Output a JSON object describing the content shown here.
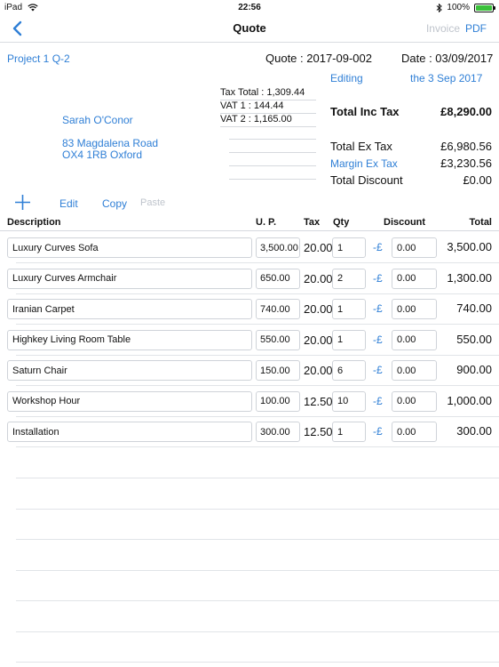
{
  "status_bar": {
    "carrier": "iPad",
    "time": "22:56",
    "battery": "100%"
  },
  "nav": {
    "title": "Quote",
    "invoice_label": "Invoice",
    "pdf_label": "PDF"
  },
  "header": {
    "project": "Project 1 Q-2",
    "quote_no": "Quote : 2017-09-002",
    "date": "Date : 03/09/2017",
    "editing": "Editing",
    "editing_date": "the 3 Sep 2017",
    "tax_total": "Tax Total : 1,309.44",
    "vat1": "VAT 1 :  144.44",
    "vat2": "VAT 2 :  1,165.00",
    "customer_name": "Sarah O'Conor",
    "address_line1": "83 Magdalena Road",
    "address_line2": "OX4 1RB Oxford"
  },
  "totals": {
    "inc_tax_label": "Total Inc Tax",
    "inc_tax_value": "£8,290.00",
    "ex_tax_label": "Total Ex Tax",
    "ex_tax_value": "£6,980.56",
    "margin_label": "Margin Ex Tax",
    "margin_value": "£3,230.56",
    "discount_label": "Total Discount",
    "discount_value": "£0.00"
  },
  "toolbar": {
    "add": "+",
    "edit": "Edit",
    "copy": "Copy",
    "paste": "Paste"
  },
  "columns": {
    "description": "Description",
    "up": "U. P.",
    "tax": "Tax",
    "qty": "Qty",
    "discount": "Discount",
    "total": "Total"
  },
  "rows": [
    {
      "description": "Luxury Curves Sofa",
      "up": "3,500.00",
      "tax": "20.00",
      "qty": "1",
      "disc_type": "-£",
      "discount": "0.00",
      "total": "3,500.00"
    },
    {
      "description": "Luxury Curves Armchair",
      "up": "650.00",
      "tax": "20.00",
      "qty": "2",
      "disc_type": "-£",
      "discount": "0.00",
      "total": "1,300.00"
    },
    {
      "description": "Iranian Carpet",
      "up": "740.00",
      "tax": "20.00",
      "qty": "1",
      "disc_type": "-£",
      "discount": "0.00",
      "total": "740.00"
    },
    {
      "description": "Highkey Living Room Table",
      "up": "550.00",
      "tax": "20.00",
      "qty": "1",
      "disc_type": "-£",
      "discount": "0.00",
      "total": "550.00"
    },
    {
      "description": "Saturn Chair",
      "up": "150.00",
      "tax": "20.00",
      "qty": "6",
      "disc_type": "-£",
      "discount": "0.00",
      "total": "900.00"
    },
    {
      "description": "Workshop Hour",
      "up": "100.00",
      "tax": "12.50",
      "qty": "10",
      "disc_type": "-£",
      "discount": "0.00",
      "total": "1,000.00"
    },
    {
      "description": "Installation",
      "up": "300.00",
      "tax": "12.50",
      "qty": "1",
      "disc_type": "-£",
      "discount": "0.00",
      "total": "300.00"
    }
  ]
}
